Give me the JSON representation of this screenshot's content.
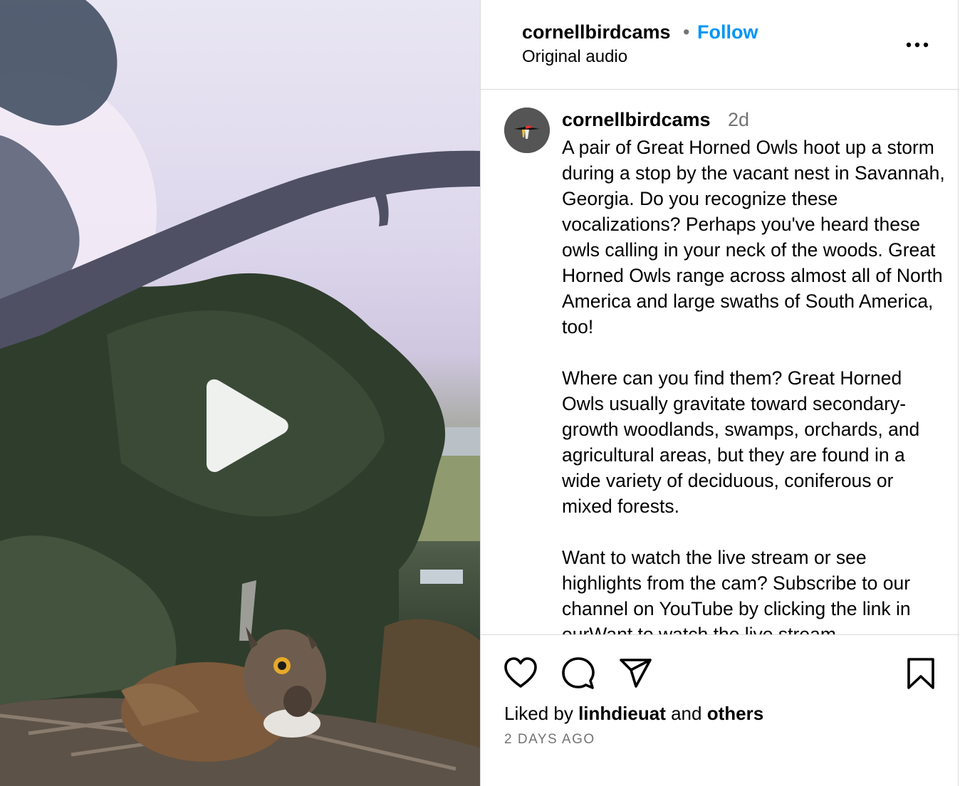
{
  "header": {
    "username": "cornellbirdcams",
    "separator": "•",
    "follow_label": "Follow",
    "audio_label": "Original audio",
    "more_icon": "more-horizontal-icon"
  },
  "caption": {
    "username": "cornellbirdcams",
    "time": "2d",
    "text": "A pair of Great Horned Owls hoot up a storm during a stop by the vacant nest in Savannah, Georgia. Do you recognize these vocalizations? Perhaps you've heard these owls calling in your neck of the woods. Great Horned Owls range across almost all of North America and large swaths of South America, too!\n\nWhere can you find them? Great Horned Owls usually gravitate toward secondary-growth woodlands, swamps, orchards, and agricultural areas, but they are found in a wide variety of deciduous, coniferous or mixed forests.\n\nWant to watch the live stream or see highlights from the cam? Subscribe to our channel on YouTube by clicking the link in ourWant to watch the live stream"
  },
  "actions": {
    "like_icon": "heart-icon",
    "comment_icon": "comment-icon",
    "share_icon": "send-icon",
    "save_icon": "bookmark-icon"
  },
  "likes": {
    "prefix": "Liked by",
    "user": "linhdieuat",
    "conjunction": "and",
    "others": "others"
  },
  "timestamp": "2 DAYS AGO",
  "media": {
    "play_icon": "play-icon"
  }
}
